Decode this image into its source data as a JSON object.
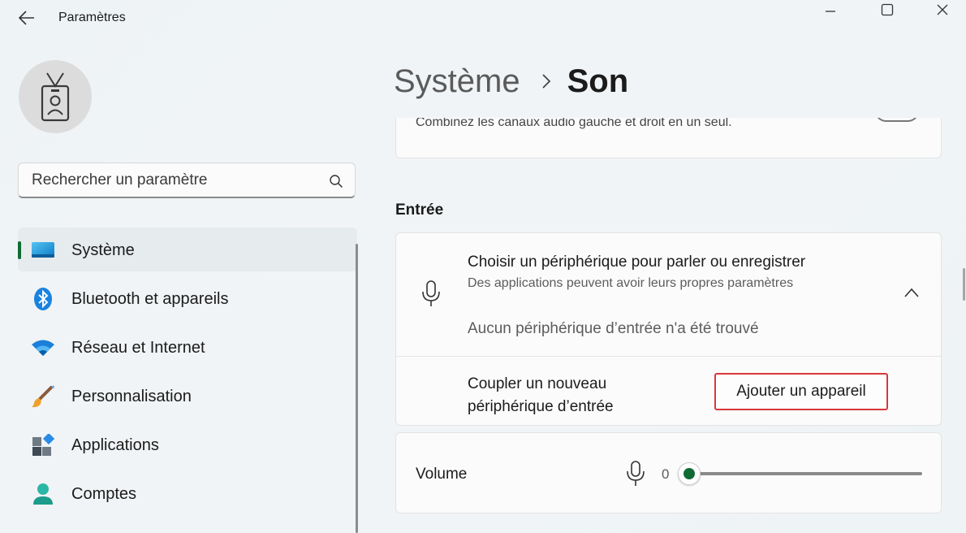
{
  "app": {
    "title": "Paramètres"
  },
  "search": {
    "placeholder": "Rechercher un paramètre"
  },
  "nav": {
    "items": [
      {
        "label": "Système",
        "icon": "monitor-icon",
        "selected": true
      },
      {
        "label": "Bluetooth et appareils",
        "icon": "bluetooth-icon"
      },
      {
        "label": "Réseau et Internet",
        "icon": "wifi-icon"
      },
      {
        "label": "Personnalisation",
        "icon": "brush-icon"
      },
      {
        "label": "Applications",
        "icon": "apps-icon"
      },
      {
        "label": "Comptes",
        "icon": "account-icon"
      }
    ]
  },
  "breadcrumb": {
    "parent": "Système",
    "current": "Son"
  },
  "top_card": {
    "text": "Combinez les canaux audio gauche et droit en un seul."
  },
  "input_section": {
    "title": "Entrée",
    "choose_title": "Choisir un périphérique pour parler ou enregistrer",
    "choose_subtitle": "Des applications peuvent avoir leurs propres paramètres",
    "no_device": "Aucun périphérique d’entrée n'a été trouvé",
    "pair_label": "Coupler un nouveau périphérique d’entrée",
    "add_button": "Ajouter un appareil"
  },
  "volume": {
    "label": "Volume",
    "value": "0",
    "level": 0
  },
  "colors": {
    "accent": "#0d6b33",
    "highlight": "#d93838"
  }
}
